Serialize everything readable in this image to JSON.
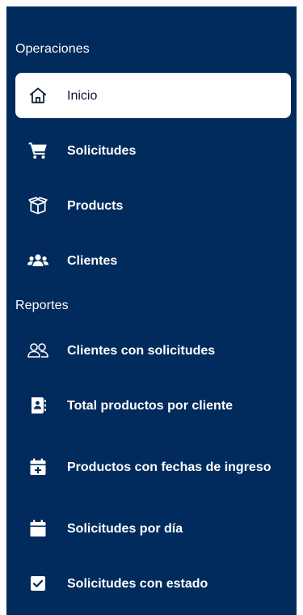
{
  "colors": {
    "sidebar_bg": "#002b5c",
    "active_bg": "#ffffff",
    "text": "#ffffff",
    "active_text": "#0b1b33"
  },
  "sections": [
    {
      "title": "Operaciones",
      "items": [
        {
          "label": "Inicio",
          "icon": "home-icon",
          "active": true
        },
        {
          "label": "Solicitudes",
          "icon": "cart-icon"
        },
        {
          "label": "Products",
          "icon": "box-icon"
        },
        {
          "label": "Clientes",
          "icon": "users-icon"
        }
      ]
    },
    {
      "title": "Reportes",
      "items": [
        {
          "label": "Clientes con solicitudes",
          "icon": "users-outline-icon"
        },
        {
          "label": "Total productos por cliente",
          "icon": "contact-book-icon"
        },
        {
          "label": "Productos con fechas de ingreso",
          "icon": "calendar-plus-icon"
        },
        {
          "label": "Solicitudes por día",
          "icon": "calendar-icon"
        },
        {
          "label": "Solicitudes con estado",
          "icon": "checkbox-icon"
        }
      ]
    }
  ]
}
